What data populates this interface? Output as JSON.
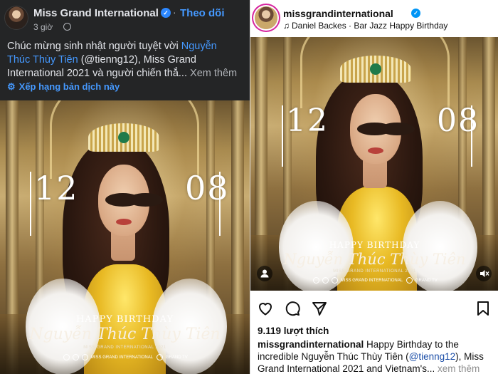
{
  "facebook": {
    "page_name": "Miss Grand International",
    "follow_label": "Theo dõi",
    "time_label": "3 giờ",
    "caption": {
      "line1_text": "Chúc mừng sinh nhật người tuyệt vời ",
      "line1_link": "Nguyễn",
      "line2_link": "Thúc Thùy Tiên",
      "line2_text": " (@tienng12), Miss Grand",
      "line3_text": "International 2021 và người chiến thắ...",
      "line3_more": " Xem thêm"
    },
    "translate_label": "Xếp hạng bản dịch này",
    "translate_icon": "gear-icon"
  },
  "poster": {
    "date_left": "12",
    "date_right": "08",
    "happy_birthday": "HAPPY BIRTHDAY",
    "name": "Nguyễn Thúc Thùy Tiên",
    "org": "MISS GRAND INTERNATIONAL 2021",
    "social_org": "MISS GRAND INTERNATIONAL",
    "social_tv": "GRAND TV"
  },
  "instagram": {
    "username": "missgrandinternational",
    "music": "Daniel Backes · Bar Jazz Happy Birthday",
    "likes": "9.119 lượt thích",
    "caption": {
      "user": "missgrandinternational",
      "line1_text": " Happy Birthday to the",
      "line2_text": "incredible Nguyễn Thúc Thùy Tiên (",
      "line2_link": "@tienng12",
      "line2_tail": "), Miss",
      "line3_text": "Grand International 2021 and Vietnam's...",
      "line3_more": " xem thêm"
    }
  },
  "colors": {
    "fb_bg": "#242526",
    "fb_blue": "#4599ff",
    "ig_verified": "#0095f6",
    "gold": "#e8b923"
  }
}
